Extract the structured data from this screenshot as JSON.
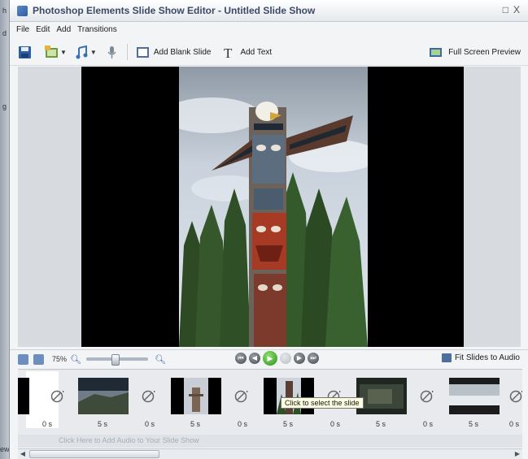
{
  "window": {
    "title": "Photoshop Elements Slide Show Editor - Untitled Slide Show",
    "controls": [
      "□",
      "X"
    ]
  },
  "menu": [
    "File",
    "Edit",
    "Add",
    "Transitions"
  ],
  "toolbar": {
    "add_blank_slide": "Add Blank Slide",
    "add_text": "Add Text",
    "full_screen_preview": "Full Screen Preview"
  },
  "controls": {
    "zoom_level": "75%",
    "zoom_value": 0.45,
    "fit_slides_to_audio": "Fit Slides to Audio"
  },
  "filmstrip": {
    "slides": [
      {
        "duration": "5 s"
      },
      {
        "duration": "5 s"
      },
      {
        "duration": "5 s"
      },
      {
        "duration": "5 s"
      },
      {
        "duration": "5 s"
      }
    ],
    "transitions": [
      {
        "duration": "0 s"
      },
      {
        "duration": "0 s"
      },
      {
        "duration": "0 s"
      },
      {
        "duration": "0 s"
      },
      {
        "duration": "0 s"
      },
      {
        "duration": "0 s"
      }
    ],
    "tooltip": "Click to select the slide"
  },
  "audio_track": {
    "placeholder": "Click Here to Add Audio to Your Slide Show"
  },
  "left_strip_fragments": [
    "h",
    "d",
    "g",
    "ew"
  ],
  "colors": {
    "accent": "#385d9b",
    "play": "#2e8d1b"
  }
}
